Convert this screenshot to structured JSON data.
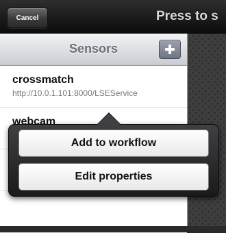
{
  "topbar": {
    "cancel_label": "Cancel",
    "title": "Press to s"
  },
  "panel": {
    "title": "Sensors",
    "add_icon": "plus-icon",
    "rows": [
      {
        "name": "crossmatch",
        "url": "http://10.0.1.101:8000/LSEService"
      },
      {
        "name": "webcam",
        "url": ""
      },
      {
        "name": "",
        "url": ""
      },
      {
        "name": "",
        "url": ""
      }
    ]
  },
  "popover": {
    "add_to_workflow": "Add to workflow",
    "edit_properties": "Edit properties"
  }
}
